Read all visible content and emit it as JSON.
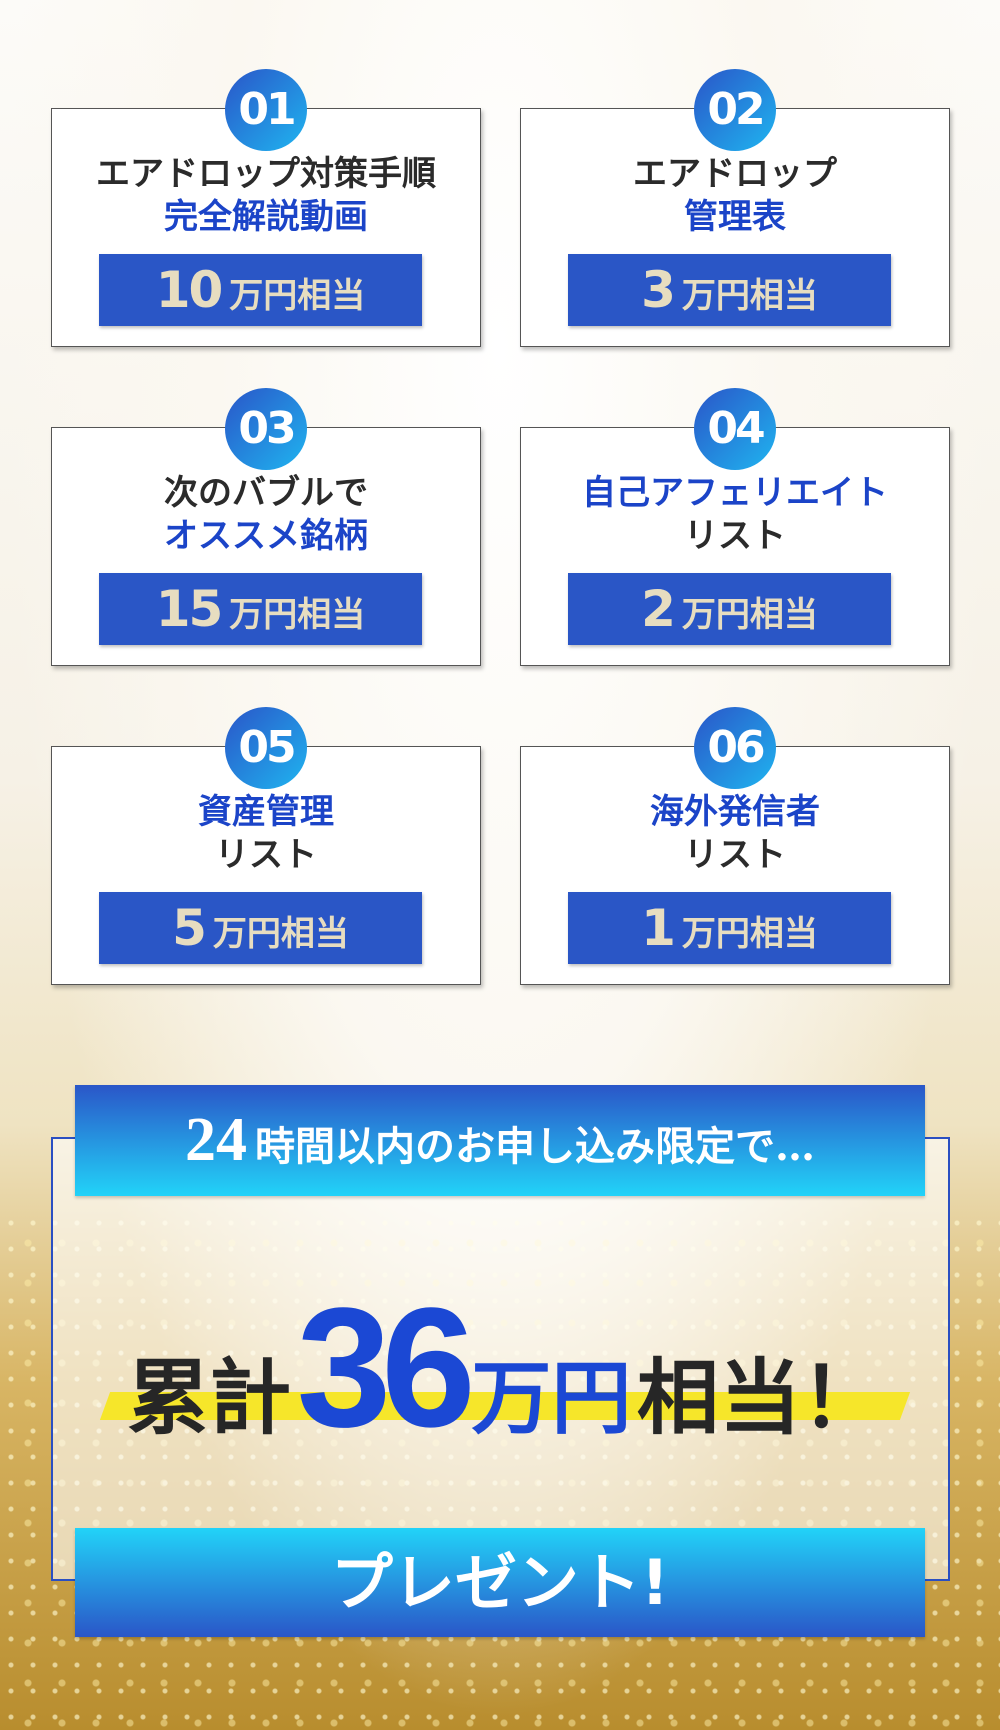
{
  "items": [
    {
      "number": "01",
      "line1": "エアドロップ対策手順",
      "line1_color": "dark",
      "line2": "完全解説動画",
      "line2_color": "blue",
      "value": "10",
      "unit": "万円相当"
    },
    {
      "number": "02",
      "line1": "エアドロップ",
      "line1_color": "dark",
      "line2": "管理表",
      "line2_color": "blue",
      "value": "3",
      "unit": "万円相当"
    },
    {
      "number": "03",
      "line1": "次のバブルで",
      "line1_color": "dark",
      "line2": "オススメ銘柄",
      "line2_color": "blue",
      "value": "15",
      "unit": "万円相当"
    },
    {
      "number": "04",
      "line1": "自己アフェリエイト",
      "line1_color": "blue",
      "line2": "リスト",
      "line2_color": "dark",
      "value": "2",
      "unit": "万円相当"
    },
    {
      "number": "05",
      "line1": "資産管理",
      "line1_color": "blue",
      "line2": "リスト",
      "line2_color": "dark",
      "value": "5",
      "unit": "万円相当"
    },
    {
      "number": "06",
      "line1": "海外発信者",
      "line1_color": "blue",
      "line2": "リスト",
      "line2_color": "dark",
      "value": "1",
      "unit": "万円相当"
    }
  ],
  "offer": {
    "limit_number": "24",
    "limit_text": "時間以内のお申し込み限定で…",
    "total_prefix": "累計",
    "total_value": "36",
    "total_unit": "万円",
    "total_suffix": "相当！",
    "cta": "プレゼント!"
  },
  "colors": {
    "accent_blue": "#2a56c6",
    "highlight_yellow": "#f6e62a",
    "value_gold": "#e7ddc0"
  }
}
